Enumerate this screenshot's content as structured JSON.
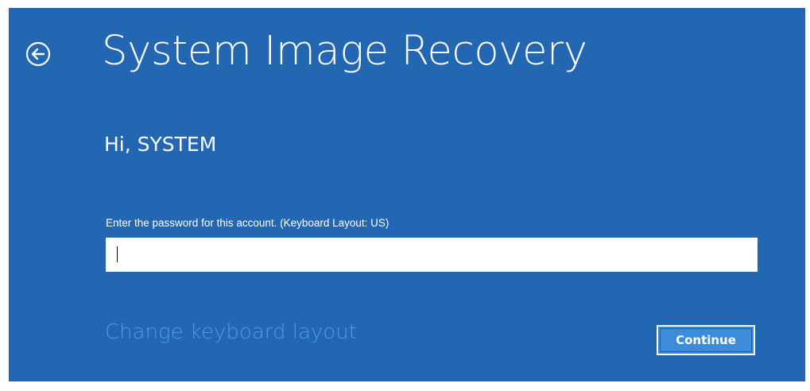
{
  "page": {
    "title": "System Image Recovery",
    "back_icon": "back-arrow-circle-icon"
  },
  "account": {
    "greeting": "Hi, SYSTEM"
  },
  "password": {
    "label": "Enter the password for this account. (Keyboard Layout: US)",
    "value": "",
    "placeholder": ""
  },
  "actions": {
    "change_layout_label": "Change keyboard layout",
    "continue_label": "Continue"
  },
  "colors": {
    "background": "#2367b3",
    "link": "#4a9be6",
    "button_fill": "#3d8bdb",
    "text": "#ffffff"
  }
}
